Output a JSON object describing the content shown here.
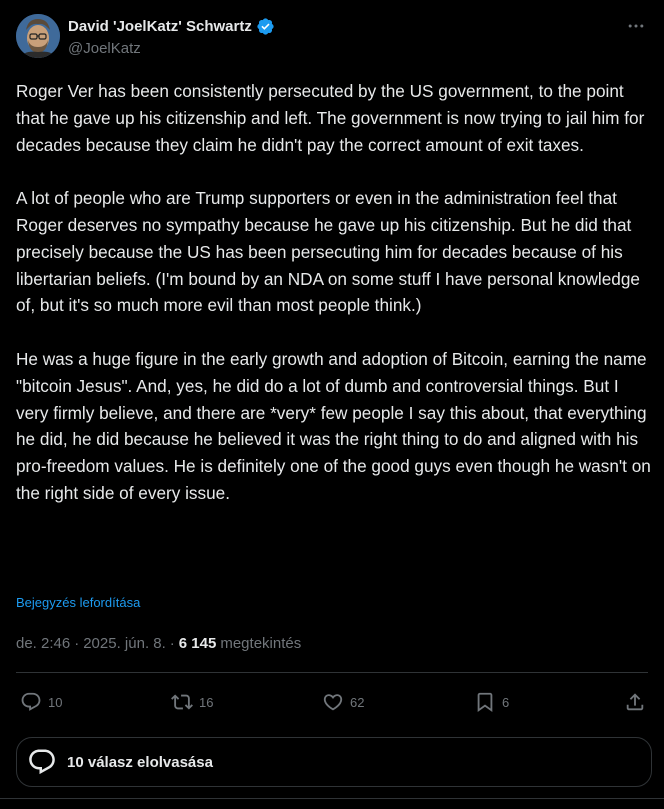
{
  "author": {
    "display_name": "David 'JoelKatz' Schwartz",
    "handle": "@JoelKatz",
    "verified": true
  },
  "tweet": {
    "paragraphs": [
      "Roger Ver has been consistently persecuted by the US government, to the point that he gave up his citizenship and left. The government is now trying to jail him for decades because they claim he didn't pay the correct amount of exit taxes.",
      "A lot of people who are Trump supporters or even in the administration feel that Roger deserves no sympathy because he gave up his citizenship. But he did that precisely because the US has been persecuting him for decades because of his libertarian beliefs. (I'm bound by an NDA on some stuff I have personal knowledge of, but it's so much more evil than most people think.)",
      "He was a huge figure in the early growth and adoption of Bitcoin, earning the name \"bitcoin Jesus\". And, yes, he did do a lot of dumb and controversial things. But I very firmly believe, and there are *very* few people I say this about, that everything he did, he did because he believed it was the right thing to do and aligned with his pro-freedom values. He is definitely one of the good guys even though he wasn't on the right side of every issue."
    ],
    "translate_label": "Bejegyzés lefordítása",
    "time": "de. 2:46",
    "separator": "·",
    "date": "2025. jún. 8.",
    "views_count": "6 145",
    "views_label": "megtekintés"
  },
  "actions": {
    "replies": "10",
    "reposts": "16",
    "likes": "62",
    "bookmarks": "6"
  },
  "read_replies_label": "10 válasz elolvasása",
  "icons": {
    "more": "more-horizontal-icon",
    "reply": "reply-icon",
    "repost": "repost-icon",
    "like": "heart-icon",
    "bookmark": "bookmark-icon",
    "share": "share-icon",
    "verified": "verified-badge-icon"
  },
  "colors": {
    "background": "#000000",
    "text": "#e7e9ea",
    "muted": "#71767b",
    "accent": "#1d9bf0",
    "border": "#2f3336"
  }
}
